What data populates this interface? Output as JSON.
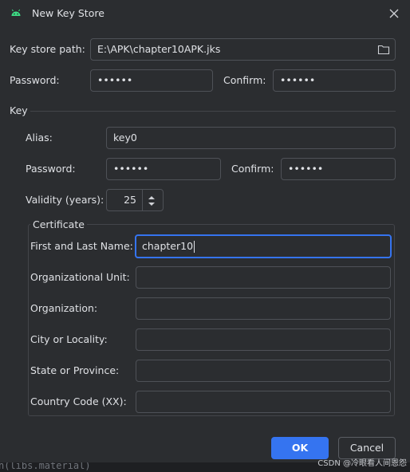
{
  "window": {
    "title": "New Key Store"
  },
  "keystore": {
    "path_label": "Key store path:",
    "path_value": "E:\\APK\\chapter10APK.jks",
    "password_label": "Password:",
    "password_value": "••••••",
    "confirm_label": "Confirm:",
    "confirm_value": "••••••"
  },
  "key": {
    "section_label": "Key",
    "alias_label": "Alias:",
    "alias_value": "key0",
    "password_label": "Password:",
    "password_value": "••••••",
    "confirm_label": "Confirm:",
    "confirm_value": "••••••",
    "validity_label": "Validity (years):",
    "validity_value": "25"
  },
  "certificate": {
    "group_label": "Certificate",
    "first_last_label": "First and Last Name:",
    "first_last_value": "chapter10",
    "org_unit_label": "Organizational Unit:",
    "org_unit_value": "",
    "org_label": "Organization:",
    "org_value": "",
    "city_label": "City or Locality:",
    "city_value": "",
    "state_label": "State or Province:",
    "state_value": "",
    "country_label": "Country Code (XX):",
    "country_value": ""
  },
  "buttons": {
    "ok": "OK",
    "cancel": "Cancel"
  },
  "background": {
    "code_fragment": "n(libs.material)",
    "watermark": "CSDN @冷眼看人间恩怨"
  },
  "colors": {
    "accent": "#3574f0",
    "background": "#2b2d30",
    "android_green": "#3ddc84"
  }
}
